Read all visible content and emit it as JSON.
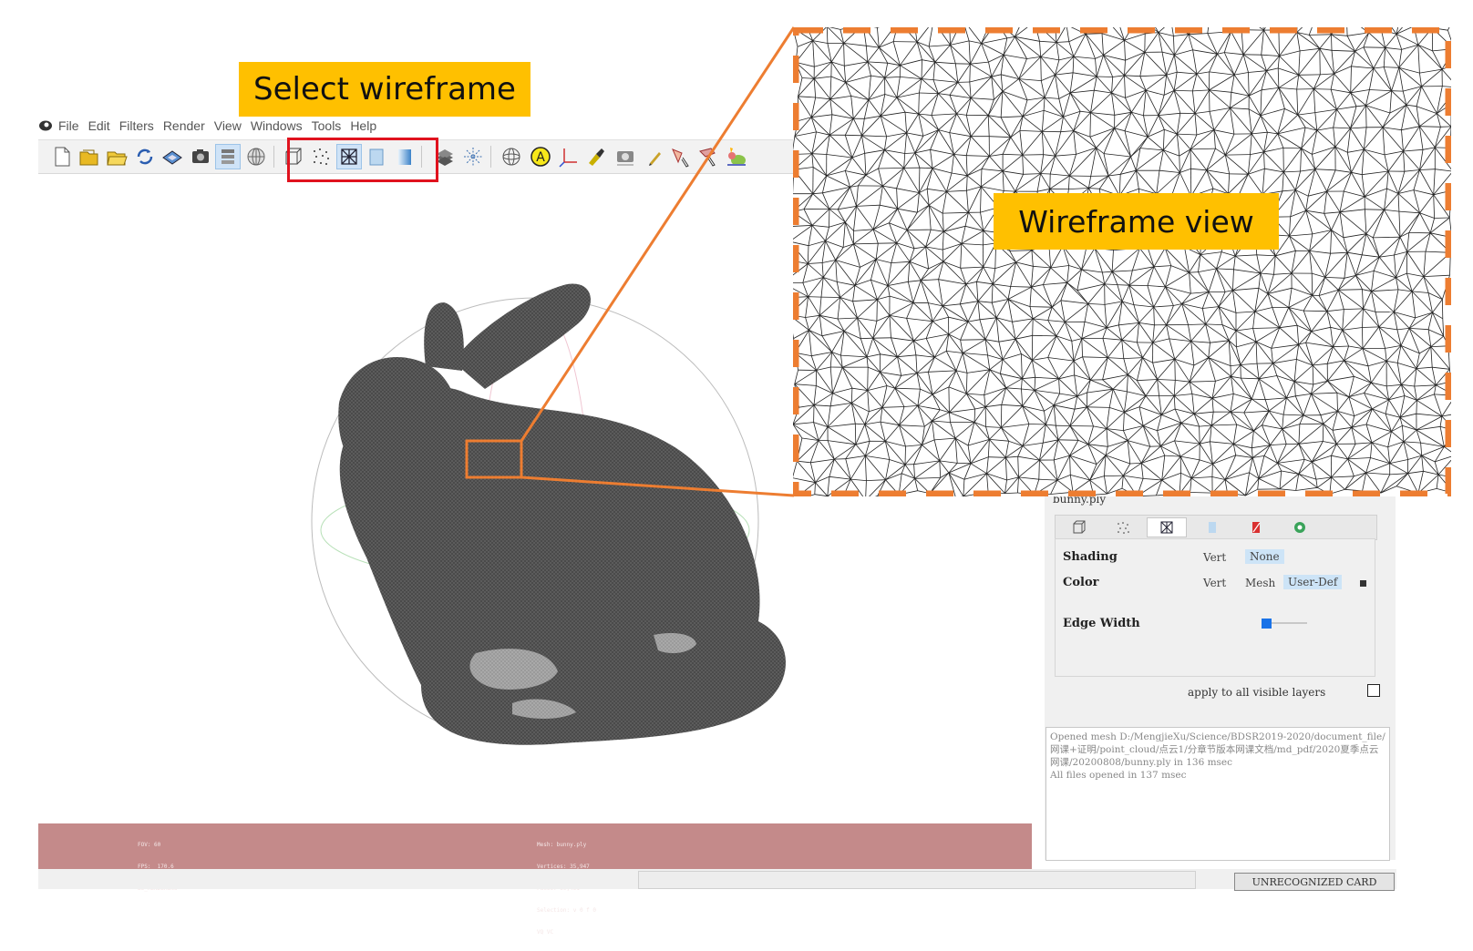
{
  "callouts": {
    "select": "Select wireframe",
    "view": "Wireframe view"
  },
  "menu": [
    "File",
    "Edit",
    "Filters",
    "Render",
    "View",
    "Windows",
    "Tools",
    "Help"
  ],
  "toolbar_icons": [
    "new-file-icon",
    "open-project-icon",
    "open-folder-icon",
    "reload-icon",
    "save-icon",
    "snapshot-icon",
    "layers-icon",
    "globe-icon",
    "bounding-box-icon",
    "points-icon",
    "wireframe-icon",
    "flat-icon",
    "smooth-icon",
    "texture-icon",
    "axes-icon",
    "trackball-icon",
    "annotation-a-icon",
    "measure-icon",
    "paint-icon",
    "camera-icon",
    "pencil-icon",
    "select-faces-icon",
    "select-vertices-icon",
    "bunny-icon"
  ],
  "active_mode": "wireframe",
  "info": {
    "left": [
      "FOV: 60",
      "FPS:  170.6",
      "BO_RENDERING"
    ],
    "right": [
      "Mesh: bunny.ply",
      "Vertices: 35,947",
      "Faces: 69,451",
      "Selection: v 0 f 0",
      "VQ VC"
    ]
  },
  "status": {
    "card": "UNRECOGNIZED CARD"
  },
  "panel": {
    "layer_name": "bunny.ply",
    "tabs": [
      "box-mode-icon",
      "points-mode-icon",
      "wireframe-mode-icon",
      "flat-mode-icon",
      "texture-mode-icon",
      "options-icon"
    ],
    "shading": {
      "label": "Shading",
      "options": [
        "Vert",
        "None"
      ],
      "selected": "None"
    },
    "color": {
      "label": "Color",
      "options": [
        "Vert",
        "Mesh",
        "User-Def"
      ],
      "selected": "User-Def",
      "swatch": "#333333"
    },
    "edge_width": {
      "label": "Edge Width",
      "level": 0.1
    },
    "apply_all": "apply to all visible layers"
  },
  "log": [
    "Opened mesh D:/MengjieXu/Science/BDSR2019-2020/document_file/网课+证明/point_cloud/点云1/分章节版本网课文档/md_pdf/2020夏季点云网课/20200808/bunny.ply in 136 msec",
    "All files opened in 137 msec"
  ],
  "colors": {
    "callout": "#FFC000",
    "highlight_box": "#E0121E",
    "zoom_border": "#ED7D31",
    "info_bar": "#C48A8A"
  }
}
